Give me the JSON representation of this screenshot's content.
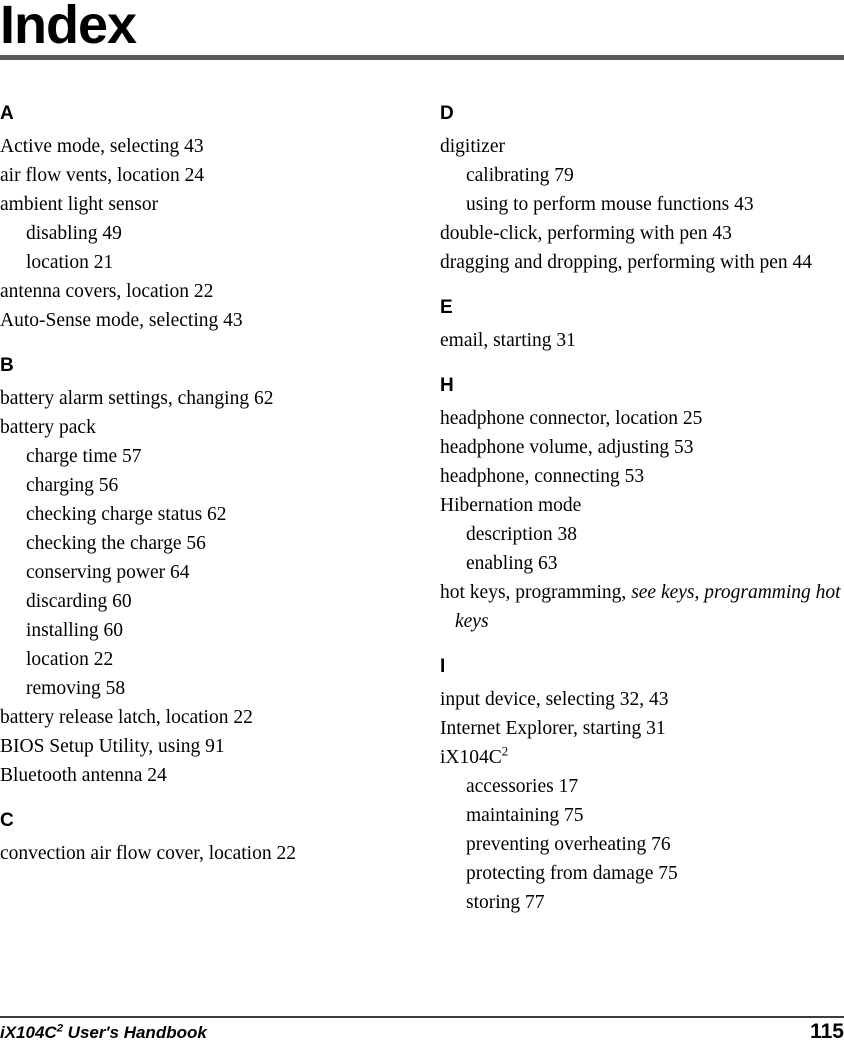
{
  "document": {
    "title": "Index",
    "header_rule_color": "#5a5a5a",
    "footer_rule_color": "#3d3d3d"
  },
  "columns": [
    {
      "name": "left",
      "sections": [
        {
          "letter": "A",
          "entries": [
            {
              "level": 1,
              "text": "Active mode, selecting 43"
            },
            {
              "level": 1,
              "text": "air flow vents, location 24"
            },
            {
              "level": 1,
              "text": "ambient light sensor"
            },
            {
              "level": 2,
              "text": "disabling 49"
            },
            {
              "level": 2,
              "text": "location 21"
            },
            {
              "level": 1,
              "text": "antenna covers, location 22"
            },
            {
              "level": 1,
              "text": "Auto-Sense mode, selecting 43"
            }
          ]
        },
        {
          "letter": "B",
          "entries": [
            {
              "level": 1,
              "text": "battery alarm settings, changing 62"
            },
            {
              "level": 1,
              "text": "battery pack"
            },
            {
              "level": 2,
              "text": "charge time 57"
            },
            {
              "level": 2,
              "text": "charging 56"
            },
            {
              "level": 2,
              "text": "checking charge status 62"
            },
            {
              "level": 2,
              "text": "checking the charge 56"
            },
            {
              "level": 2,
              "text": "conserving power 64"
            },
            {
              "level": 2,
              "text": "discarding 60"
            },
            {
              "level": 2,
              "text": "installing 60"
            },
            {
              "level": 2,
              "text": "location 22"
            },
            {
              "level": 2,
              "text": "removing 58"
            },
            {
              "level": 1,
              "text": "battery release latch, location 22"
            },
            {
              "level": 1,
              "text": "BIOS Setup Utility, using 91"
            },
            {
              "level": 1,
              "text": "Bluetooth antenna 24"
            }
          ]
        },
        {
          "letter": "C",
          "entries": [
            {
              "level": 1,
              "text": "convection air flow cover, location 22"
            }
          ]
        }
      ]
    },
    {
      "name": "right",
      "sections": [
        {
          "letter": "D",
          "entries": [
            {
              "level": 1,
              "text": "digitizer"
            },
            {
              "level": 2,
              "text": "calibrating 79"
            },
            {
              "level": 2,
              "text": "using to perform mouse functions 43"
            },
            {
              "level": 1,
              "text": "double-click, performing with pen 43"
            },
            {
              "level": 1,
              "text": "dragging and dropping, performing with pen 44"
            }
          ]
        },
        {
          "letter": "E",
          "entries": [
            {
              "level": 1,
              "text": "email, starting 31"
            }
          ]
        },
        {
          "letter": "H",
          "entries": [
            {
              "level": 1,
              "text": "headphone connector, location 25"
            },
            {
              "level": 1,
              "text": "headphone volume, adjusting 53"
            },
            {
              "level": 1,
              "text": "headphone, connecting 53"
            },
            {
              "level": 1,
              "text": "Hibernation mode"
            },
            {
              "level": 2,
              "text": "description 38"
            },
            {
              "level": 2,
              "text": "enabling 63"
            },
            {
              "level": 1,
              "wrap": true,
              "text_plain": "hot keys, programming, ",
              "text_italic": "see keys, programming hot keys"
            }
          ]
        },
        {
          "letter": "I",
          "entries": [
            {
              "level": 1,
              "text": "input device, selecting 32, 43"
            },
            {
              "level": 1,
              "text": "Internet Explorer, starting 31"
            },
            {
              "level": 1,
              "superscript": true,
              "text_base": "iX104C",
              "text_sup": "2"
            },
            {
              "level": 2,
              "text": "accessories 17"
            },
            {
              "level": 2,
              "text": "maintaining 75"
            },
            {
              "level": 2,
              "text": "preventing overheating 76"
            },
            {
              "level": 2,
              "text": "protecting from damage 75"
            },
            {
              "level": 2,
              "text": "storing 77"
            }
          ]
        }
      ]
    }
  ],
  "footer": {
    "handbook_base": "iX104C",
    "handbook_sup": "2",
    "handbook_rest": " User's Handbook",
    "page_number": "115"
  }
}
